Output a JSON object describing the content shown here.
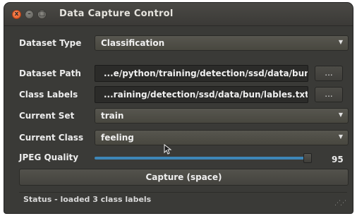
{
  "window": {
    "title": "Data Capture Control",
    "close_glyph": "x",
    "minimize_glyph": "–",
    "maximize_glyph": "□"
  },
  "dataset_type": {
    "label": "Dataset Type",
    "value": "Classification"
  },
  "dataset_path": {
    "label": "Dataset Path",
    "value": "...e/python/training/detection/ssd/data/bun",
    "browse_label": "..."
  },
  "class_labels": {
    "label": "Class Labels",
    "value": "...raining/detection/ssd/data/bun/lables.txt",
    "browse_label": "..."
  },
  "current_set": {
    "label": "Current Set",
    "value": "train"
  },
  "current_class": {
    "label": "Current Class",
    "value": "feeling"
  },
  "jpeg_quality": {
    "label": "JPEG Quality",
    "value": "95",
    "fraction": 0.95
  },
  "capture_button": {
    "label": "Capture (space)"
  },
  "status": {
    "text": "Status - loaded 3 class labels"
  },
  "icons": {
    "dropdown": "chevron-down-icon",
    "cursor": "mouse-pointer-icon",
    "resize": "resize-grip-icon"
  },
  "colors": {
    "window_bg": "#3a3a37",
    "close_button": "#e0541f",
    "slider_accent": "#3d86b7"
  }
}
